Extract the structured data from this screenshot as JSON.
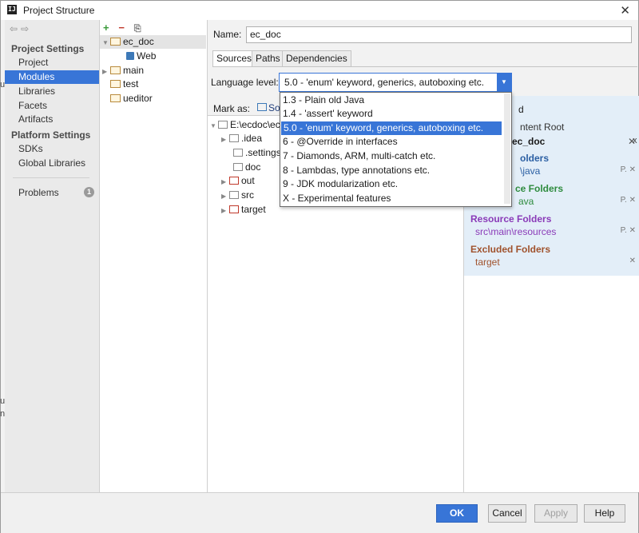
{
  "window": {
    "title": "Project Structure"
  },
  "sidebar": {
    "project_settings_header": "Project Settings",
    "platform_settings_header": "Platform Settings",
    "items": [
      {
        "label": "Project"
      },
      {
        "label": "Modules"
      },
      {
        "label": "Libraries"
      },
      {
        "label": "Facets"
      },
      {
        "label": "Artifacts"
      },
      {
        "label": "SDKs"
      },
      {
        "label": "Global Libraries"
      },
      {
        "label": "Problems"
      }
    ],
    "problems_count": "1"
  },
  "module_tree": {
    "toolbar": {
      "add": "+",
      "remove": "−"
    },
    "nodes": [
      {
        "label": "ec_doc"
      },
      {
        "label": "Web"
      },
      {
        "label": "main"
      },
      {
        "label": "test"
      },
      {
        "label": "ueditor"
      }
    ]
  },
  "module": {
    "name_label": "Name:",
    "name_value": "ec_doc",
    "tabs": [
      {
        "label": "Sources"
      },
      {
        "label": "Paths"
      },
      {
        "label": "Dependencies"
      }
    ],
    "language_level_label": "Language level:",
    "language_level_value": "5.0 - 'enum' keyword, generics, autoboxing etc.",
    "language_level_options": [
      "1.3 - Plain old Java",
      "1.4 - 'assert' keyword",
      "5.0 - 'enum' keyword, generics, autoboxing etc.",
      "6 - @Override in interfaces",
      "7 - Diamonds, ARM, multi-catch etc.",
      "8 - Lambdas, type annotations etc.",
      "9 - JDK modularization etc.",
      "X - Experimental features"
    ],
    "mark_as_label": "Mark as:",
    "mark_as_sources": "So",
    "content_tree": [
      {
        "label": "E:\\ecdoc\\ec"
      },
      {
        "label": ".idea"
      },
      {
        "label": ".settings"
      },
      {
        "label": "doc"
      },
      {
        "label": "out"
      },
      {
        "label": "src"
      },
      {
        "label": "target"
      }
    ]
  },
  "content_root": {
    "header_partial": "ntent Root",
    "name_partial": "ec_doc",
    "right_col_partial": "d",
    "source_header_partial": "olders",
    "source_value_partial": "\\java",
    "test_header_partial": "ce Folders",
    "test_value_partial": "ava",
    "resource_header": "Resource Folders",
    "resource_value": "src\\main\\resources",
    "excluded_header": "Excluded Folders",
    "excluded_value": "target",
    "colors": {
      "source": "#2b5fa3",
      "test": "#2e8b3e",
      "resource": "#8a3ab8",
      "excluded": "#a0522d"
    }
  },
  "footer": {
    "ok": "OK",
    "cancel": "Cancel",
    "apply": "Apply",
    "help": "Help"
  },
  "background_fragments": {
    "a": "u",
    "b": "u",
    "c": "n",
    "d": "x"
  }
}
